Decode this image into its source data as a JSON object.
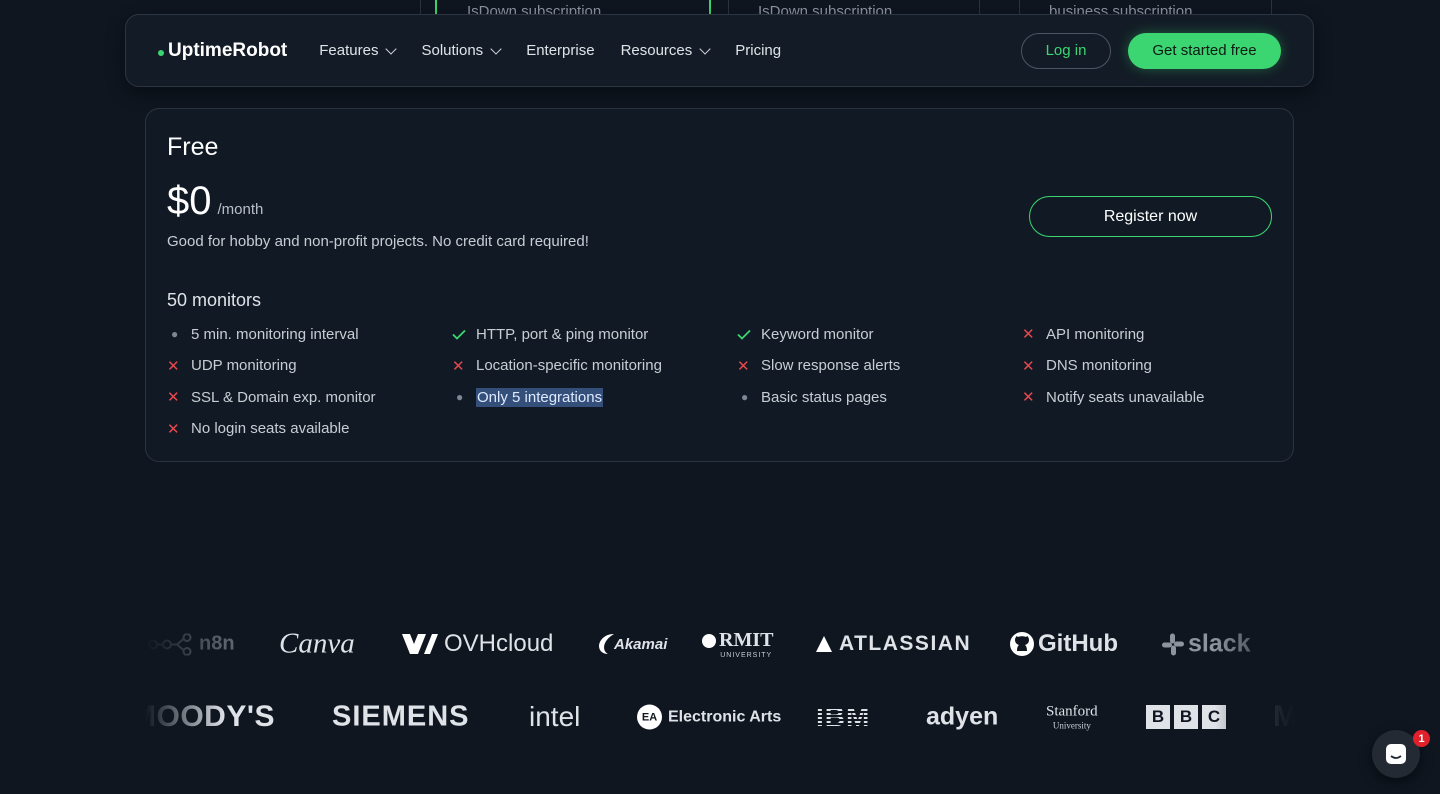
{
  "peek": {
    "subs": [
      "IsDown subscription",
      "IsDown subscription",
      "business subscription"
    ]
  },
  "navbar": {
    "brand": "UptimeRobot",
    "items": [
      {
        "label": "Features",
        "dropdown": true
      },
      {
        "label": "Solutions",
        "dropdown": true
      },
      {
        "label": "Enterprise",
        "dropdown": false
      },
      {
        "label": "Resources",
        "dropdown": true
      },
      {
        "label": "Pricing",
        "dropdown": false
      }
    ],
    "login_label": "Log in",
    "start_label": "Get started free"
  },
  "plan": {
    "name": "Free",
    "price": "$0",
    "period": "/month",
    "description": "Good for hobby and non-profit projects. No credit card required!",
    "register_label": "Register now",
    "monitors": "50 monitors",
    "features": [
      {
        "text": "5 min. monitoring interval",
        "status": "dot"
      },
      {
        "text": "HTTP, port & ping monitor",
        "status": "check"
      },
      {
        "text": "Keyword monitor",
        "status": "check"
      },
      {
        "text": "API monitoring",
        "status": "x"
      },
      {
        "text": "UDP monitoring",
        "status": "x"
      },
      {
        "text": "Location-specific monitoring",
        "status": "x"
      },
      {
        "text": "Slow response alerts",
        "status": "x"
      },
      {
        "text": "DNS monitoring",
        "status": "x"
      },
      {
        "text": "SSL & Domain exp. monitor",
        "status": "x"
      },
      {
        "text": "Only 5 integrations",
        "status": "dot",
        "highlighted": true
      },
      {
        "text": "Basic status pages",
        "status": "dot"
      },
      {
        "text": "Notify seats unavailable",
        "status": "x"
      },
      {
        "text": "No login seats available",
        "status": "x"
      }
    ]
  },
  "logos": {
    "row1": [
      "n8n",
      "Canva",
      "OVHcloud",
      "Akamai",
      "RMIT",
      "UNIVERSITY",
      "ATLASSIAN",
      "GitHub",
      "slack"
    ],
    "row2": [
      "MOODY'S",
      "SIEMENS",
      "intel",
      "EA",
      "Electronic Arts",
      "IBM",
      "adyen",
      "Stanford",
      "University",
      "B",
      "B",
      "C",
      "M"
    ]
  },
  "chat": {
    "badge": "1"
  },
  "colors": {
    "accent": "#3bd671",
    "background": "#0f1620",
    "x_mark": "#e5484d"
  }
}
